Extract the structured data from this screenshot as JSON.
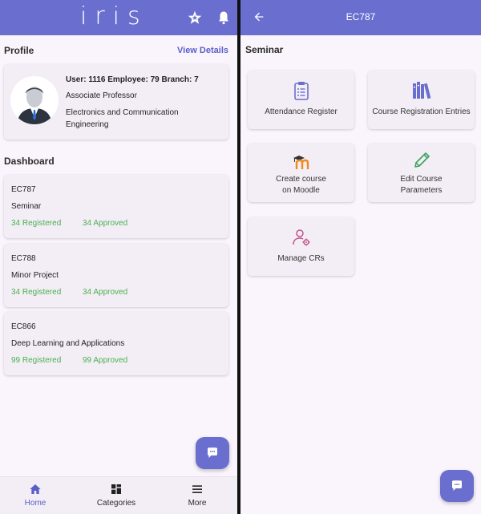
{
  "left": {
    "app_logo": "iris",
    "profile": {
      "title": "Profile",
      "view_details": "View Details",
      "line1": "User: 1116 Employee: 79 Branch: 7",
      "designation": "Associate Professor",
      "department_line1": "Electronics and Communication",
      "department_line2": "Engineering"
    },
    "dashboard": {
      "title": "Dashboard",
      "cards": [
        {
          "code": "EC787",
          "name": "Seminar",
          "registered": "34 Registered",
          "approved": "34 Approved"
        },
        {
          "code": "EC788",
          "name": "Minor Project",
          "registered": "34 Registered",
          "approved": "34 Approved"
        },
        {
          "code": "EC866",
          "name": "Deep Learning and Applications",
          "registered": "99 Registered",
          "approved": "99 Approved"
        }
      ]
    },
    "bottom_nav": [
      {
        "label": "Home",
        "icon": "home-icon",
        "active": true
      },
      {
        "label": "Categories",
        "icon": "grid-icon",
        "active": false
      },
      {
        "label": "More",
        "icon": "menu-icon",
        "active": false
      }
    ]
  },
  "right": {
    "title": "EC787",
    "section": "Seminar",
    "tiles": [
      {
        "label": "Attendance Register",
        "icon": "clipboard-list-icon"
      },
      {
        "label": "Course Registration Entries",
        "icon": "books-icon"
      },
      {
        "label_line1": "Create course",
        "label_line2": "on Moodle",
        "icon": "moodle-icon"
      },
      {
        "label_line1": "Edit Course",
        "label_line2": "Parameters",
        "icon": "pencil-icon"
      },
      {
        "label": "Manage CRs",
        "icon": "user-gear-icon"
      }
    ]
  },
  "colors": {
    "primary": "#6a6fcf",
    "background": "#faf5fc",
    "card": "#f3eef6",
    "success": "#4caf50"
  }
}
